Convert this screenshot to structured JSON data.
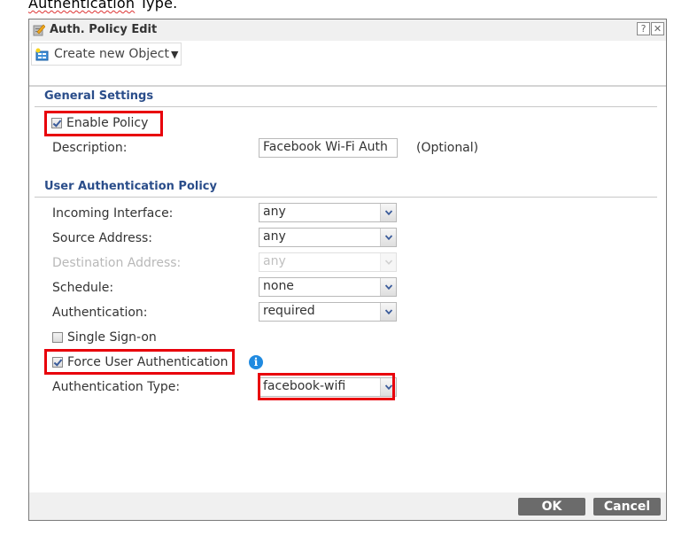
{
  "caption": {
    "word1": "Authentication",
    "word2": "Type."
  },
  "dialog": {
    "title": "Auth. Policy Edit",
    "help_label": "?",
    "close_label": "✕"
  },
  "toolbar": {
    "create_label": "Create new Object",
    "create_caret": "▼"
  },
  "general": {
    "title": "General Settings",
    "enable_policy": {
      "label": "Enable Policy",
      "checked": true
    },
    "description": {
      "label": "Description:",
      "value": "Facebook Wi-Fi Auth",
      "hint": "(Optional)"
    }
  },
  "uap": {
    "title": "User Authentication Policy",
    "incoming_interface": {
      "label": "Incoming Interface:",
      "value": "any"
    },
    "source_address": {
      "label": "Source Address:",
      "value": "any"
    },
    "destination_address": {
      "label": "Destination Address:",
      "value": "any",
      "disabled": true
    },
    "schedule": {
      "label": "Schedule:",
      "value": "none"
    },
    "authentication": {
      "label": "Authentication:",
      "value": "required"
    },
    "single_sign_on": {
      "label": "Single Sign-on",
      "checked": false
    },
    "force_user_auth": {
      "label": "Force User Authentication",
      "checked": true
    },
    "info_glyph": "i",
    "authentication_type": {
      "label": "Authentication Type:",
      "value": "facebook-wifi"
    }
  },
  "footer": {
    "ok_label": "OK",
    "cancel_label": "Cancel"
  },
  "colors": {
    "section_title": "#2a4d8a",
    "highlight": "#e8000b",
    "button_bg": "#6b6b6b",
    "info_icon": "#1f8ae0"
  }
}
